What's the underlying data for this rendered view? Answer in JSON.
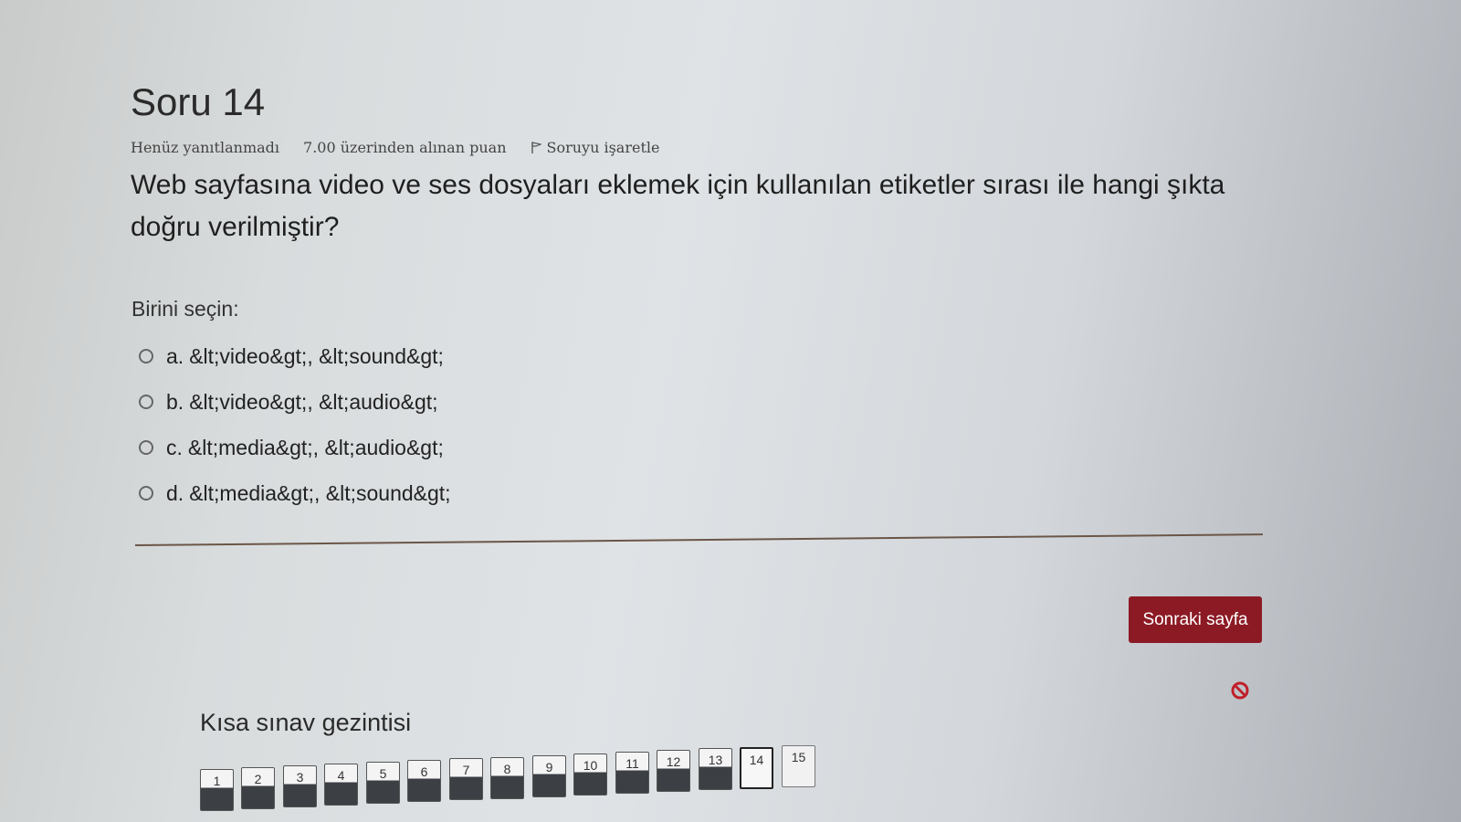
{
  "question": {
    "title": "Soru 14",
    "status": "Henüz yanıtlanmadı",
    "points": "7.00 üzerinden alınan puan",
    "flag_label": "Soruyu işaretle",
    "text": "Web sayfasına video ve ses dosyaları eklemek için kullanılan etiketler sırası ile hangi şıkta doğru verilmiştir?",
    "prompt": "Birini seçin:",
    "options": [
      {
        "letter": "a.",
        "label": "&lt;video&gt;, &lt;sound&gt;"
      },
      {
        "letter": "b.",
        "label": "&lt;video&gt;, &lt;audio&gt;"
      },
      {
        "letter": "c.",
        "label": "&lt;media&gt;, &lt;audio&gt;"
      },
      {
        "letter": "d.",
        "label": "&lt;media&gt;, &lt;sound&gt;"
      }
    ]
  },
  "actions": {
    "next_label": "Sonraki sayfa"
  },
  "navigation": {
    "title": "Kısa sınav gezintisi",
    "buttons": [
      "1",
      "2",
      "3",
      "4",
      "5",
      "6",
      "7",
      "8",
      "9",
      "10",
      "11",
      "12",
      "13",
      "14",
      "15"
    ],
    "current": "14"
  },
  "colors": {
    "accent": "#8c1a24",
    "nav_answered": "#3c3f44",
    "block_icon": "#c0202a"
  },
  "icons": {
    "flag": "flag-icon",
    "block": "no-entry-icon"
  }
}
